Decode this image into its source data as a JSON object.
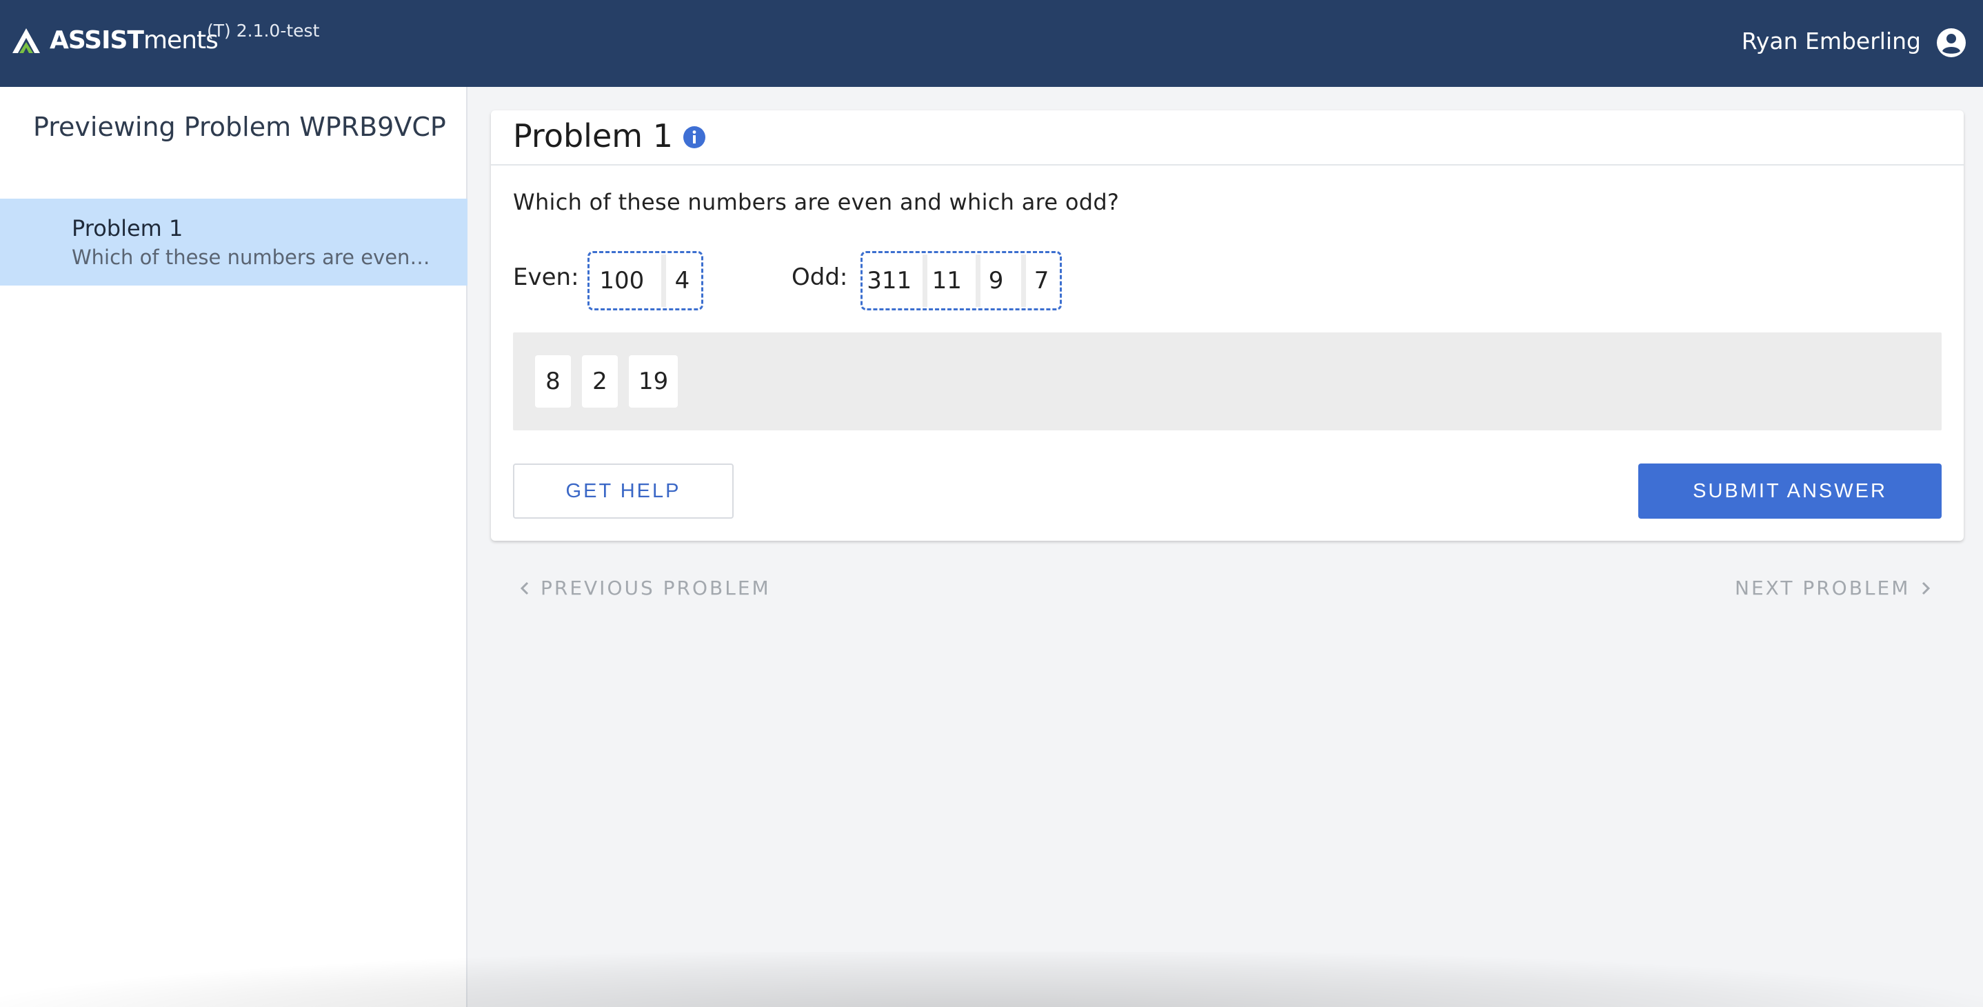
{
  "header": {
    "brand_bold": "ASSIST",
    "brand_light": "ments",
    "version": "(T) 2.1.0-test",
    "user_name": "Ryan Emberling",
    "colors": {
      "bar": "#263f66",
      "logo_green": "#7ac043"
    }
  },
  "sidebar": {
    "title": "Previewing Problem WPRB9VCP",
    "items": [
      {
        "title": "Problem 1",
        "subtitle": "Which of these numbers are even and which are odd?"
      }
    ]
  },
  "problem": {
    "title": "Problem 1",
    "question": "Which of these numbers are even and which are odd?",
    "even_label": "Even:",
    "odd_label": "Odd:",
    "even_tiles": [
      "100",
      "4"
    ],
    "odd_tiles": [
      "311",
      "11",
      "9",
      "7"
    ],
    "bank_tiles": [
      "8",
      "2",
      "19"
    ],
    "get_help_label": "GET HELP",
    "submit_label": "SUBMIT ANSWER"
  },
  "navigation": {
    "previous_label": "PREVIOUS PROBLEM",
    "next_label": "NEXT PROBLEM"
  },
  "colors": {
    "accent": "#3e6fd4",
    "selected_row": "#c6e0fb"
  }
}
